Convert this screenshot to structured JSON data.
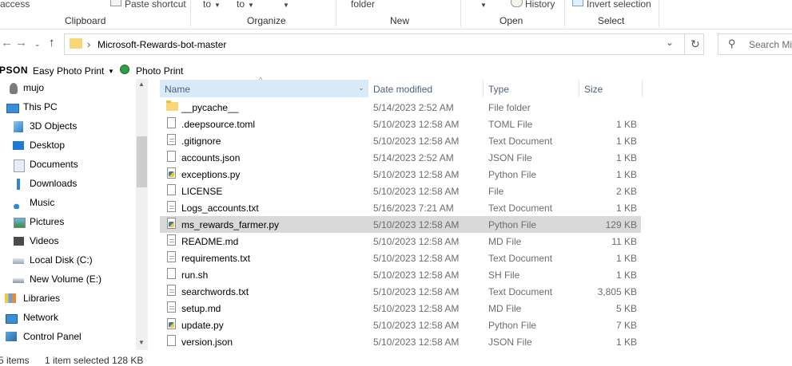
{
  "ribbon": {
    "access": "access",
    "paste_shortcut": "Paste shortcut",
    "clipboard_label": "Clipboard",
    "move_to": "to",
    "copy_to": "to",
    "organize_label": "Organize",
    "new_folder": "folder",
    "new_label": "New",
    "history": "History",
    "open_label": "Open",
    "invert_selection": "Invert selection",
    "select_label": "Select"
  },
  "address": {
    "separator": "›",
    "path": "Microsoft-Rewards-bot-master",
    "search_placeholder": "Search Mi"
  },
  "favorites": {
    "brand": "PSON",
    "easy_photo_print": "Easy Photo Print",
    "photo_print": "Photo Print"
  },
  "nav": {
    "items": [
      {
        "label": "mujo",
        "icon": "user-icon"
      },
      {
        "label": "This PC",
        "icon": "computer-icon"
      },
      {
        "label": "3D Objects",
        "icon": "cube-icon"
      },
      {
        "label": "Desktop",
        "icon": "desktop-icon"
      },
      {
        "label": "Documents",
        "icon": "documents-icon"
      },
      {
        "label": "Downloads",
        "icon": "download-arrow-icon"
      },
      {
        "label": "Music",
        "icon": "music-note-icon"
      },
      {
        "label": "Pictures",
        "icon": "pictures-icon"
      },
      {
        "label": "Videos",
        "icon": "film-icon"
      },
      {
        "label": "Local Disk (C:)",
        "icon": "drive-c-icon"
      },
      {
        "label": "New Volume (E:)",
        "icon": "drive-icon"
      },
      {
        "label": "Libraries",
        "icon": "library-icon"
      },
      {
        "label": "Network",
        "icon": "network-icon"
      },
      {
        "label": "Control Panel",
        "icon": "control-panel-icon"
      }
    ]
  },
  "columns": {
    "name": "Name",
    "date": "Date modified",
    "type": "Type",
    "size": "Size"
  },
  "files": [
    {
      "name": "__pycache__",
      "date": "5/14/2023 2:52 AM",
      "type": "File folder",
      "size": "",
      "kind": "folder"
    },
    {
      "name": ".deepsource.toml",
      "date": "5/10/2023 12:58 AM",
      "type": "TOML File",
      "size": "1 KB",
      "kind": "file"
    },
    {
      "name": ".gitignore",
      "date": "5/10/2023 12:58 AM",
      "type": "Text Document",
      "size": "1 KB",
      "kind": "text"
    },
    {
      "name": "accounts.json",
      "date": "5/14/2023 2:52 AM",
      "type": "JSON File",
      "size": "1 KB",
      "kind": "file"
    },
    {
      "name": "exceptions.py",
      "date": "5/10/2023 12:58 AM",
      "type": "Python File",
      "size": "1 KB",
      "kind": "python"
    },
    {
      "name": "LICENSE",
      "date": "5/10/2023 12:58 AM",
      "type": "File",
      "size": "2 KB",
      "kind": "file"
    },
    {
      "name": "Logs_accounts.txt",
      "date": "5/16/2023 7:21 AM",
      "type": "Text Document",
      "size": "1 KB",
      "kind": "text"
    },
    {
      "name": "ms_rewards_farmer.py",
      "date": "5/10/2023 12:58 AM",
      "type": "Python File",
      "size": "129 KB",
      "kind": "python",
      "selected": true
    },
    {
      "name": "README.md",
      "date": "5/10/2023 12:58 AM",
      "type": "MD File",
      "size": "11 KB",
      "kind": "text"
    },
    {
      "name": "requirements.txt",
      "date": "5/10/2023 12:58 AM",
      "type": "Text Document",
      "size": "1 KB",
      "kind": "text"
    },
    {
      "name": "run.sh",
      "date": "5/10/2023 12:58 AM",
      "type": "SH File",
      "size": "1 KB",
      "kind": "file"
    },
    {
      "name": "searchwords.txt",
      "date": "5/10/2023 12:58 AM",
      "type": "Text Document",
      "size": "3,805 KB",
      "kind": "text"
    },
    {
      "name": "setup.md",
      "date": "5/10/2023 12:58 AM",
      "type": "MD File",
      "size": "5 KB",
      "kind": "text"
    },
    {
      "name": "update.py",
      "date": "5/10/2023 12:58 AM",
      "type": "Python File",
      "size": "7 KB",
      "kind": "python"
    },
    {
      "name": "version.json",
      "date": "5/10/2023 12:58 AM",
      "type": "JSON File",
      "size": "1 KB",
      "kind": "file"
    }
  ],
  "status": {
    "items": "5 items",
    "selected": "1 item selected  128 KB"
  },
  "colors": {
    "selected_row": "#d9d9d9",
    "header_text": "#4d6082",
    "sort_header_bg": "#d9ebf9",
    "folder": "#f8d775"
  }
}
